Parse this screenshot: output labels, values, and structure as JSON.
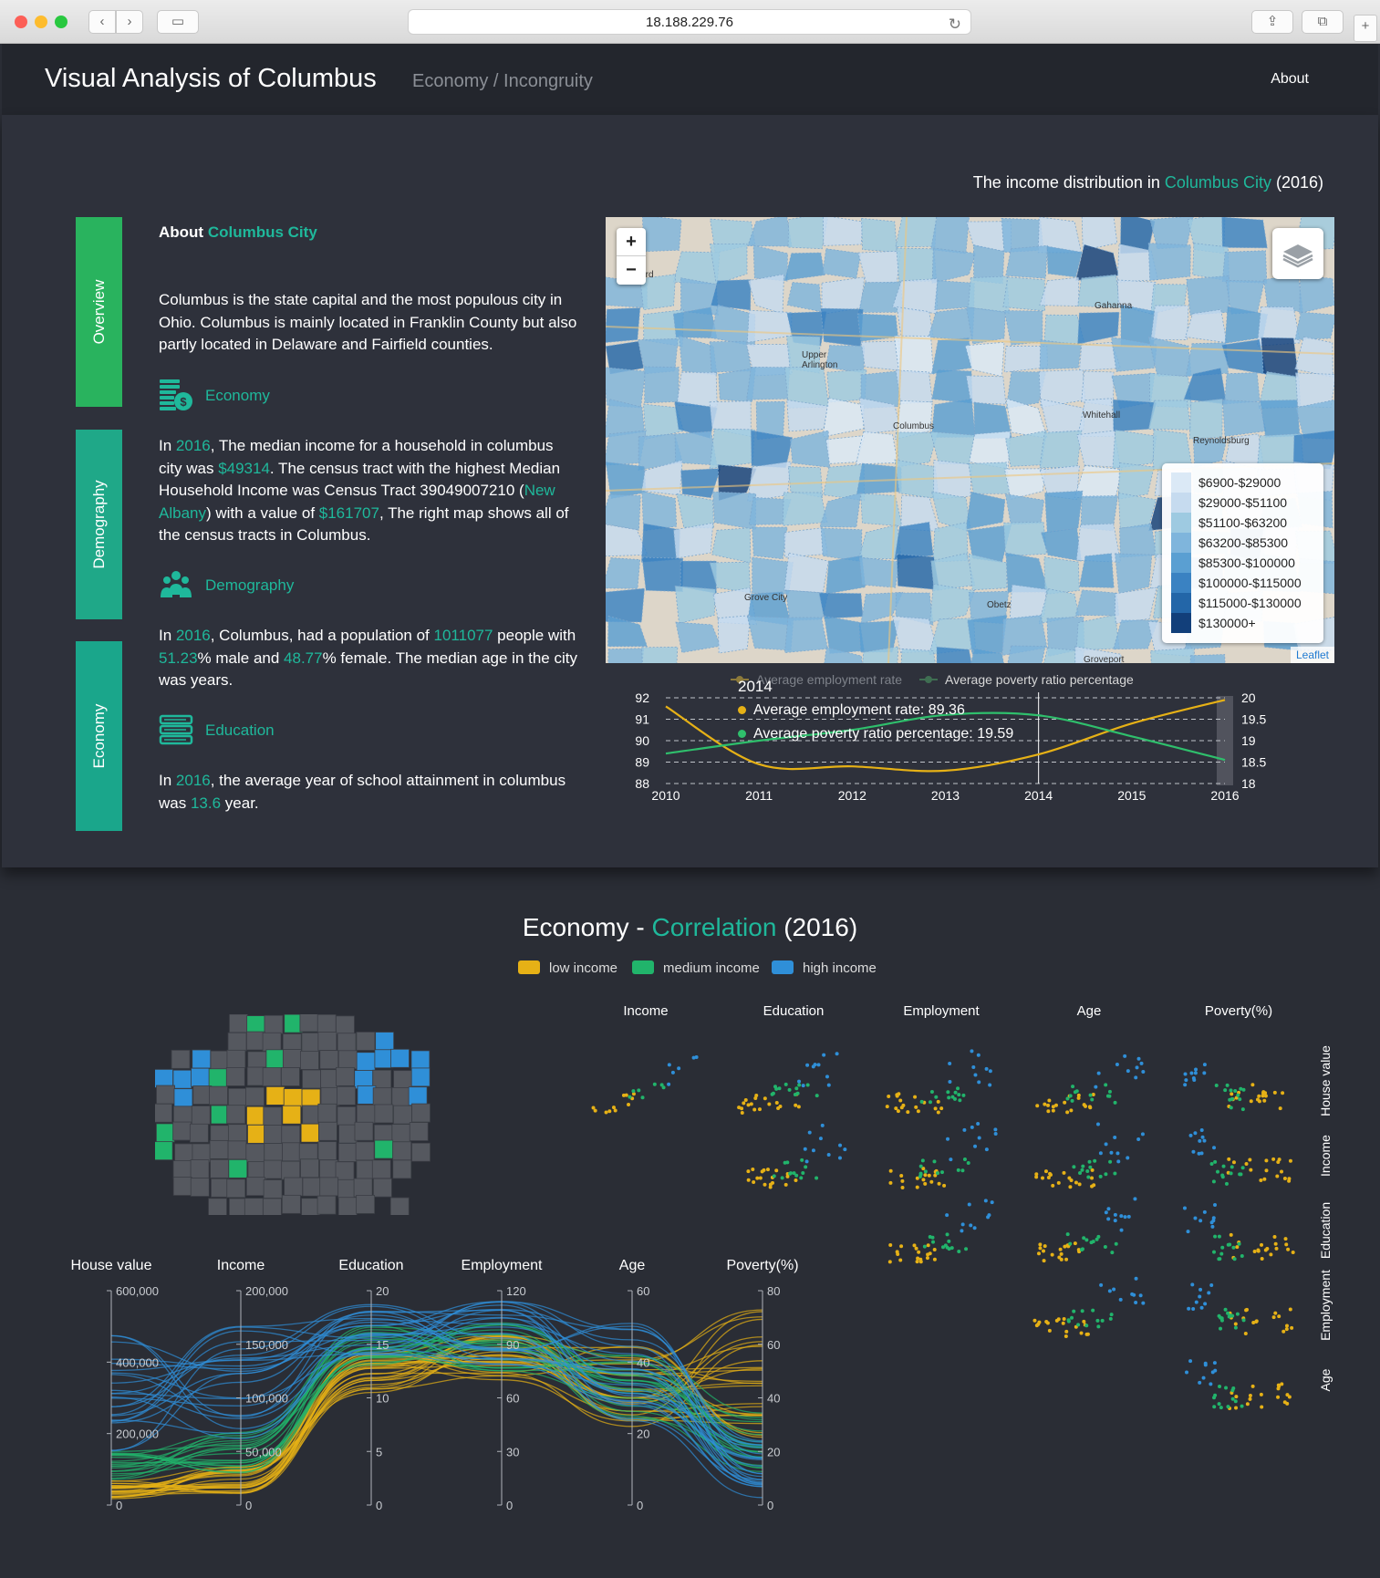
{
  "browser": {
    "url": "18.188.229.76",
    "buttons": {
      "back": "‹",
      "forward": "›",
      "sidebar": "▭",
      "share": "⇪",
      "tabs": "⧉",
      "newtab": "+",
      "reload": "↻"
    }
  },
  "navbar": {
    "brand": "Visual Analysis of Columbus",
    "breadcrumb": "Economy / Incongruity",
    "about": "About"
  },
  "tabs": [
    {
      "label": "Overview",
      "color": "#29b35e"
    },
    {
      "label": "Demography",
      "color": "#1fa888"
    },
    {
      "label": "Economy",
      "color": "#1aa68b"
    }
  ],
  "about": {
    "prefix": "About ",
    "city": "Columbus City",
    "intro": "Columbus is the state capital and the most populous city in Ohio. Columbus is mainly located in Franklin County but also partly located in Delaware and Fairfield counties."
  },
  "sections": {
    "economy": {
      "label": "Economy",
      "icon": "money-icon",
      "t1": "In ",
      "year": "2016",
      "t2": ", The median income for a household in columbus city was ",
      "income": "$49314",
      "t3": ". The census tract with the highest Median Household Income was Census Tract 39049007210 (",
      "tract": "New Albany",
      "t4": ") with a value of ",
      "top_value": "$161707",
      "t5": ", The right map shows all of the census tracts in Columbus."
    },
    "demography": {
      "label": "Demography",
      "icon": "people-icon",
      "t1": "In ",
      "year": "2016",
      "t2": ", Columbus, had a population of ",
      "population": "1011077",
      "t3": " people with ",
      "male": "51.23",
      "t4": "% male and ",
      "female": "48.77",
      "t5": "% female. The median age in the city was years."
    },
    "education": {
      "label": "Education",
      "icon": "books-icon",
      "t1": "In ",
      "year": "2016",
      "t2": ", the average year of school attainment in columbus was ",
      "years": "13.6",
      "t3": " year."
    }
  },
  "map": {
    "caption_prefix": "The income distribution in ",
    "caption_city": "Columbus City",
    "caption_suffix": " (2016)",
    "zoom_in": "+",
    "zoom_out": "−",
    "attribution": "Leaflet",
    "place_labels": [
      "Gahanna",
      "Whitehall",
      "Reynoldsburg",
      "Columbus",
      "Grove City",
      "Upper Arlington",
      "Hilliard",
      "Obetz",
      "Groveport"
    ],
    "legend": [
      {
        "label": "$6900-$29000",
        "color": "#dbe9f6"
      },
      {
        "label": "$29000-$51100",
        "color": "#c6dbef"
      },
      {
        "label": "$51100-$63200",
        "color": "#9ecae1"
      },
      {
        "label": "$63200-$85300",
        "color": "#7fb5dc"
      },
      {
        "label": "$85300-$100000",
        "color": "#5a9fd2"
      },
      {
        "label": "$100000-$115000",
        "color": "#3a82c2"
      },
      {
        "label": "$115000-$130000",
        "color": "#2366a8"
      },
      {
        "label": "$130000+",
        "color": "#123f7a"
      }
    ]
  },
  "chart_data": [
    {
      "type": "line",
      "legend": [
        "Average employment rate",
        "Average poverty ratio percentage"
      ],
      "x": [
        2010,
        2011,
        2012,
        2013,
        2014,
        2015,
        2016
      ],
      "series": [
        {
          "name": "Average employment rate",
          "axis": "left",
          "color": "#e6b116",
          "values": [
            91.6,
            88.9,
            88.8,
            88.6,
            89.36,
            90.8,
            91.9
          ]
        },
        {
          "name": "Average poverty ratio percentage",
          "axis": "right",
          "color": "#2fbf6c",
          "values": [
            18.7,
            19.0,
            19.25,
            19.6,
            19.59,
            19.1,
            18.55
          ]
        }
      ],
      "ylim_left": [
        88,
        92
      ],
      "ylim_right": [
        18,
        20
      ],
      "yticks_left": [
        88,
        89,
        90,
        91,
        92
      ],
      "yticks_right": [
        18,
        18.5,
        19,
        19.5,
        20
      ],
      "tooltip": {
        "year": "2014",
        "employment": "Average employment rate: 89.36",
        "poverty": "Average poverty ratio percentage: 19.59"
      }
    },
    {
      "type": "parallel-coordinates",
      "axes": [
        {
          "label": "House value",
          "ticks": [
            "0",
            "200,000",
            "400,000",
            "600,000"
          ],
          "max": 600000
        },
        {
          "label": "Income",
          "ticks": [
            "0",
            "50,000",
            "100,000",
            "150,000",
            "200,000"
          ],
          "max": 200000
        },
        {
          "label": "Education",
          "ticks": [
            "0",
            "5",
            "10",
            "15",
            "20"
          ],
          "max": 20
        },
        {
          "label": "Employment",
          "ticks": [
            "0",
            "30",
            "60",
            "90",
            "120"
          ],
          "max": 120
        },
        {
          "label": "Age",
          "ticks": [
            "0",
            "20",
            "40",
            "60"
          ],
          "max": 60
        },
        {
          "label": "Poverty(%)",
          "ticks": [
            "0",
            "20",
            "40",
            "60",
            "80"
          ],
          "max": 80
        }
      ]
    },
    {
      "type": "scatter-matrix",
      "columns": [
        "Income",
        "Education",
        "Employment",
        "Age",
        "Poverty(%)"
      ],
      "rows": [
        "House value",
        "Income",
        "Education",
        "Employment",
        "Age"
      ]
    }
  ],
  "correlation": {
    "title_a": "Economy - ",
    "title_b": "Correlation",
    "title_c": " (2016)",
    "groups": [
      {
        "label": "low income",
        "color": "#e6b116"
      },
      {
        "label": "medium income",
        "color": "#21b46b"
      },
      {
        "label": "high income",
        "color": "#2f8fd8"
      }
    ]
  }
}
